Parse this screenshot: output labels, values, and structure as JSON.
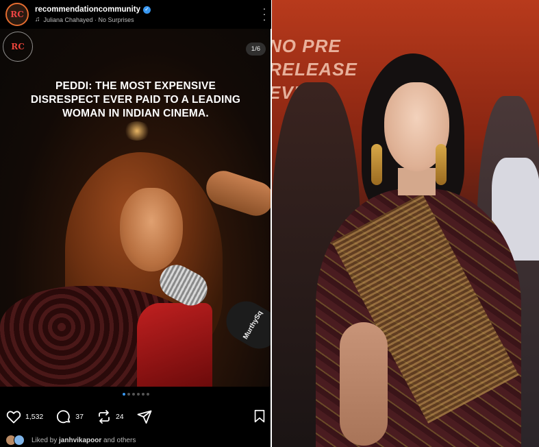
{
  "post": {
    "username": "recommendationcommunity",
    "avatar_text": "RC",
    "audio": "Juliana Chahayed · No Surprises",
    "more_icon": "more-vertical-icon",
    "image": {
      "logo_text": "RC",
      "counter": "1/6",
      "headline_line1": "PEDDI: THE MOST EXPENSIVE",
      "headline_line2": "DISRESPECT EVER PAID TO A LEADING",
      "headline_line3": "WOMAN IN INDIAN CINEMA.",
      "mic_brand": "MurthySq"
    },
    "carousel": {
      "total": 6,
      "active": 1
    },
    "actions": {
      "likes": "1,532",
      "comments": "37",
      "reposts": "24",
      "icons": [
        "heart-icon",
        "comment-icon",
        "repost-icon",
        "share-icon",
        "bookmark-icon"
      ]
    },
    "liked_by": {
      "prefix": "Liked by ",
      "user": "janhvikapoor",
      "suffix": " and others"
    },
    "accent_color": "#3897f0"
  },
  "event_photo": {
    "backdrop_text": "NO PRE RELEASE EVENT"
  }
}
